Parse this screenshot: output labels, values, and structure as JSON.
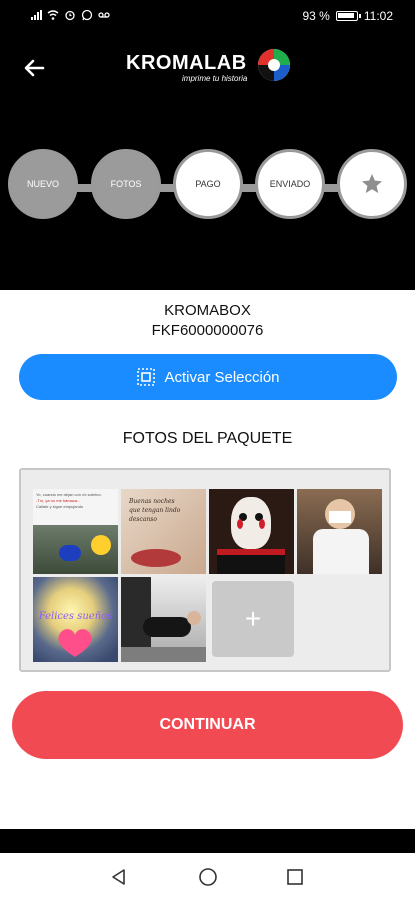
{
  "status_bar": {
    "battery": "93 %",
    "time": "11:02"
  },
  "header": {
    "logo": {
      "name": "KROMALAB",
      "tagline": "imprime tu historia"
    }
  },
  "steps": [
    {
      "label": "NUEVO",
      "state": "done"
    },
    {
      "label": "FOTOS",
      "state": "done"
    },
    {
      "label": "PAGO",
      "state": "todo"
    },
    {
      "label": "ENVIADO",
      "state": "todo"
    },
    {
      "label": "",
      "icon": "star-icon",
      "state": "todo"
    }
  ],
  "box": {
    "name": "KROMABOX",
    "code": "FKF6000000076"
  },
  "activate_button": {
    "label": "Activar Selección"
  },
  "photos_section": {
    "title": "FOTOS DEL PAQUETE",
    "thumbnails": [
      {
        "caption_line1": "Yo, cuando me dejan con mi sobrino:",
        "caption_line2": "-Tío, ya no me hamaca...",
        "caption_line3": "Callate y sigue empujando"
      },
      {
        "script_line1": "Buenas noches",
        "script_line2": "que tengan lindo",
        "script_line3": "descanso"
      },
      {},
      {},
      {
        "text": "Felices sueños"
      },
      {}
    ],
    "add_tile": {
      "symbol": "+"
    }
  },
  "continue_button": {
    "label": "CONTINUAR"
  },
  "colors": {
    "accent_blue": "#1a8cff",
    "accent_red": "#f24a52",
    "step_gray": "#9b9b9b"
  }
}
